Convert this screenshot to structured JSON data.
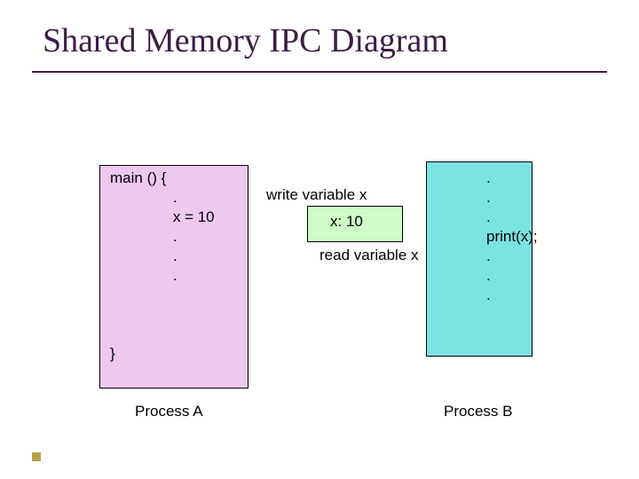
{
  "title": "Shared Memory IPC Diagram",
  "process_a": {
    "code": "main () {\n               .\n               x = 10\n               .\n               .\n               .\n\n\n\n}",
    "caption": "Process A"
  },
  "shared": {
    "value_label": "x: 10",
    "write_label": "write variable x",
    "read_label": "read variable x"
  },
  "process_b": {
    "code": ".\n.\n.\nprint(x);\n.\n.\n.",
    "caption": "Process B"
  }
}
